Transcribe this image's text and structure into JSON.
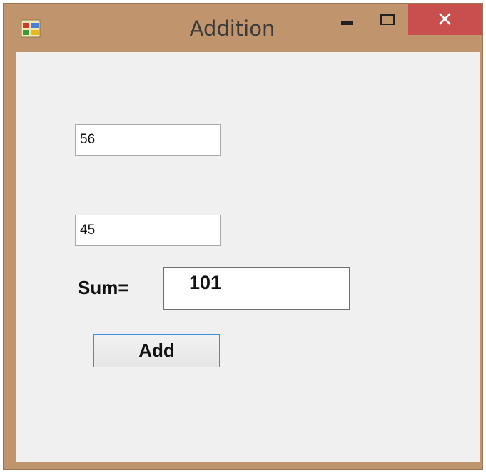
{
  "window": {
    "title": "Addition",
    "close_glyph": "×",
    "icons": {
      "app": "app-window-icon",
      "minimize": "minimize-icon",
      "maximize": "maximize-icon",
      "close": "close-icon"
    },
    "colors": {
      "frame": "#c0946d",
      "close_button": "#c94f4f",
      "client": "#f0f0f0"
    }
  },
  "form": {
    "first_number": "56",
    "second_number": "45",
    "sum_label": "Sum=",
    "sum_value": "101",
    "add_button_label": "Add"
  }
}
